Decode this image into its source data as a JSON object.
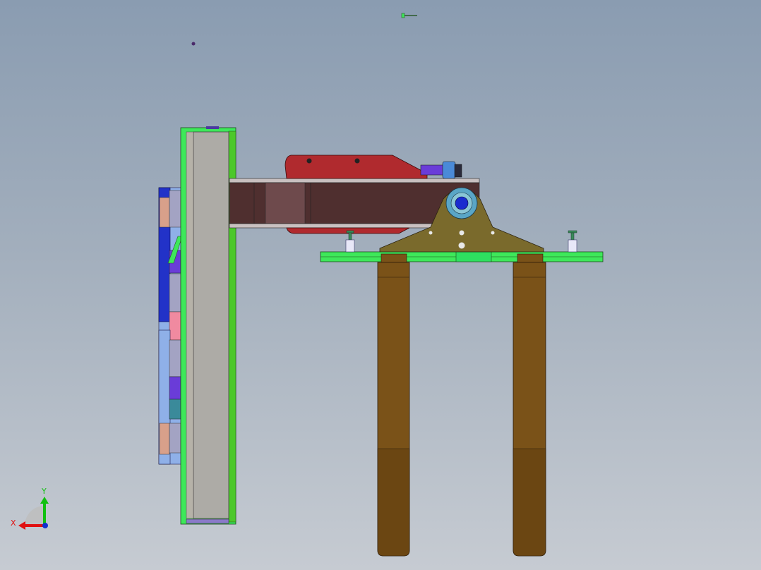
{
  "viewport": {
    "background_top": "#8a9cb1",
    "background_bottom": "#c6cbd2"
  },
  "triad": {
    "x_label": "X",
    "y_label": "Y",
    "x_color": "#e01010",
    "y_color": "#10c010",
    "z_color": "#1030d0"
  },
  "colors": {
    "plate_face": "#adaba6",
    "plate_edge": "#3ee85a",
    "plate_side": "#4cc82a",
    "beam": "#4f2f2f",
    "beam_light": "#6e4a4c",
    "cylinder_body": "#b02a2e",
    "cylinder_rod": "#6a3cd8",
    "bracket": "#7a6a2c",
    "bearing_outer": "#5aa6c6",
    "bearing_inner": "#1a2ccf",
    "fork_bar": "#3ee85a",
    "fork": "#7a5218",
    "fork_dark": "#6b4612",
    "back_blue": "#2232c8",
    "back_pink": "#f08aa0",
    "back_tan": "#d8a08a",
    "back_lightblue": "#8fb0e8",
    "back_teal": "#3a8a9a",
    "pin": "#3a8a5a"
  }
}
